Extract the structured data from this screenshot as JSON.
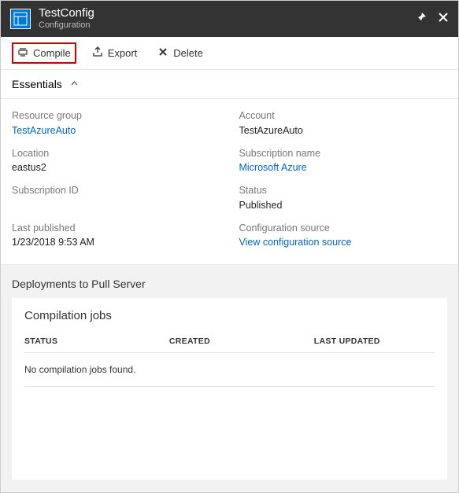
{
  "header": {
    "title": "TestConfig",
    "subtitle": "Configuration"
  },
  "toolbar": {
    "compile": "Compile",
    "export": "Export",
    "delete": "Delete"
  },
  "essentials": {
    "label": "Essentials",
    "fields": {
      "resource_group": {
        "label": "Resource group",
        "value": "TestAzureAuto"
      },
      "account": {
        "label": "Account",
        "value": "TestAzureAuto"
      },
      "location": {
        "label": "Location",
        "value": "eastus2"
      },
      "subscription_name": {
        "label": "Subscription name",
        "value": "Microsoft Azure"
      },
      "subscription_id": {
        "label": "Subscription ID",
        "value": ""
      },
      "status": {
        "label": "Status",
        "value": "Published"
      },
      "last_published": {
        "label": "Last published",
        "value": "1/23/2018 9:53 AM"
      },
      "config_source": {
        "label": "Configuration source",
        "value": "View configuration source"
      }
    }
  },
  "deployments": {
    "title": "Deployments to Pull Server",
    "panel_title": "Compilation jobs",
    "columns": {
      "status": "STATUS",
      "created": "CREATED",
      "last_updated": "LAST UPDATED"
    },
    "empty": "No compilation jobs found."
  }
}
